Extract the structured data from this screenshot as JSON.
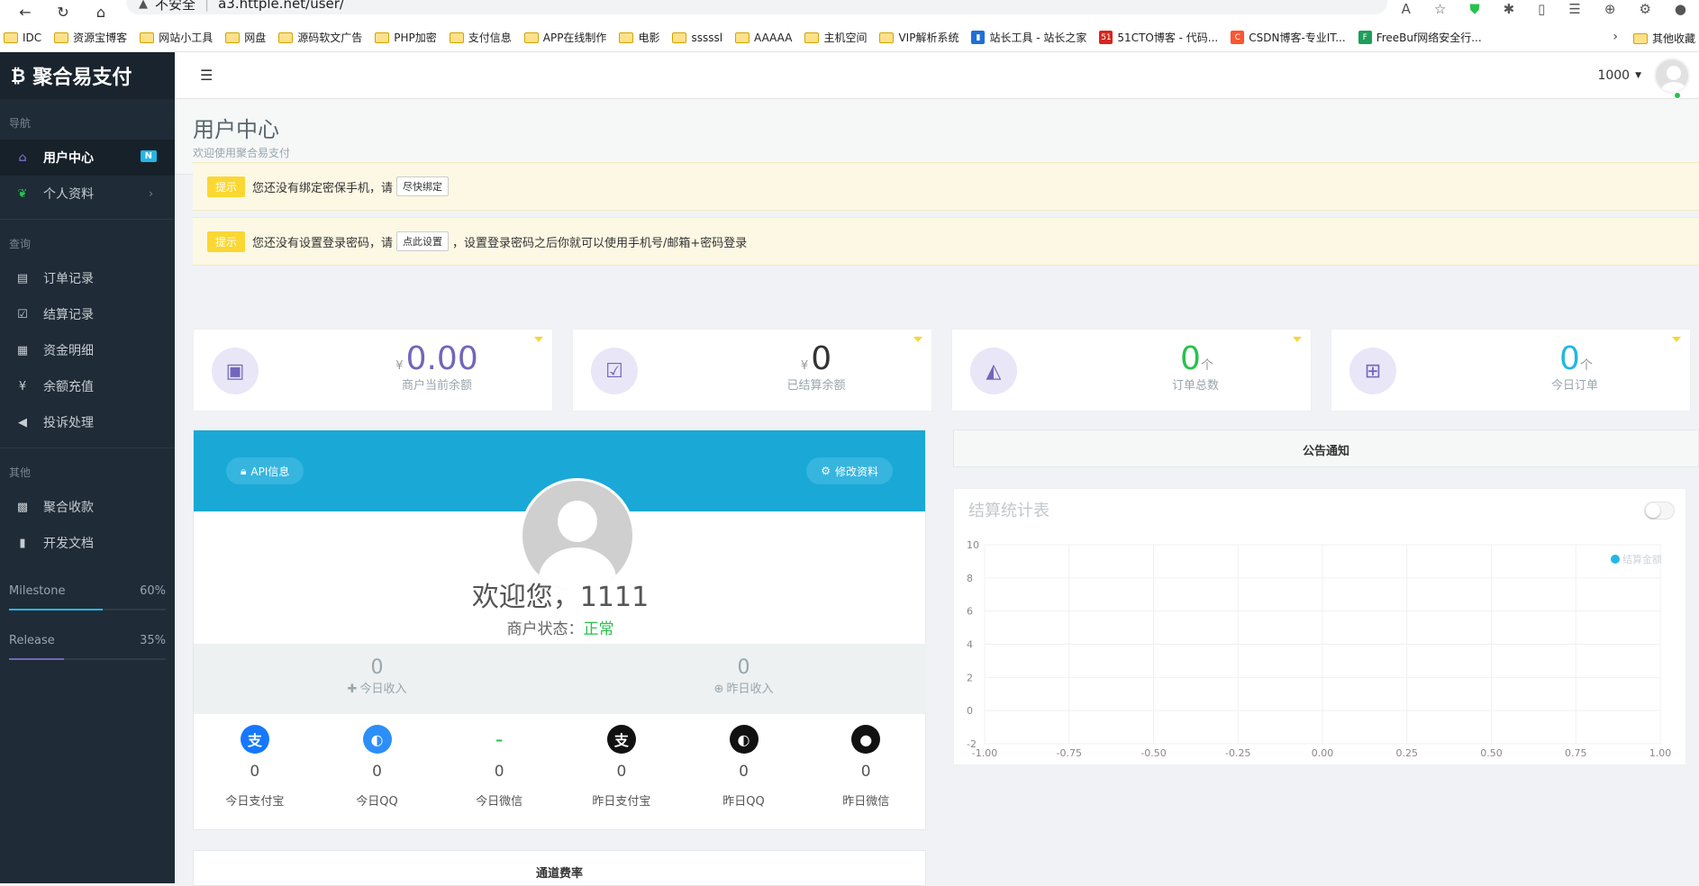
{
  "browser": {
    "security_label": "不安全",
    "url": "a3.httple.net/user/",
    "bookmarks": [
      {
        "label": "IDC",
        "type": "folder"
      },
      {
        "label": "资源宝博客",
        "type": "folder"
      },
      {
        "label": "网站小工具",
        "type": "folder"
      },
      {
        "label": "网盘",
        "type": "folder"
      },
      {
        "label": "源码软文广告",
        "type": "folder"
      },
      {
        "label": "PHP加密",
        "type": "folder"
      },
      {
        "label": "支付信息",
        "type": "folder"
      },
      {
        "label": "APP在线制作",
        "type": "folder"
      },
      {
        "label": "电影",
        "type": "folder"
      },
      {
        "label": "sssssl",
        "type": "folder"
      },
      {
        "label": "AAAAA",
        "type": "folder"
      },
      {
        "label": "主机空间",
        "type": "folder"
      },
      {
        "label": "VIP解析系统",
        "type": "folder"
      },
      {
        "label": "站长工具 - 站长之家",
        "type": "site",
        "color": "#1e6fd9",
        "glyph": "▮"
      },
      {
        "label": "51CTO博客 - 代码...",
        "type": "site",
        "color": "#d9261c",
        "glyph": "51"
      },
      {
        "label": "CSDN博客-专业IT...",
        "type": "site",
        "color": "#fc5531",
        "glyph": "C"
      },
      {
        "label": "FreeBuf网络安全行...",
        "type": "site",
        "color": "#1f9e5a",
        "glyph": "F"
      }
    ],
    "other_bookmarks": "其他收藏"
  },
  "sidebar": {
    "brand": "聚合易支付",
    "brand_icon": "bitcoin-icon",
    "sections": [
      {
        "title": "导航",
        "items": [
          {
            "label": "用户中心",
            "icon": "home-icon",
            "badge": "N",
            "active": true
          },
          {
            "label": "个人资料",
            "icon": "leaf-icon",
            "chevron": true
          }
        ]
      },
      {
        "title": "查询",
        "items": [
          {
            "label": "订单记录",
            "icon": "list-icon"
          },
          {
            "label": "结算记录",
            "icon": "check-square-icon"
          },
          {
            "label": "资金明细",
            "icon": "calendar-icon"
          },
          {
            "label": "余额充值",
            "icon": "yen-icon"
          },
          {
            "label": "投诉处理",
            "icon": "bullhorn-icon"
          }
        ]
      },
      {
        "title": "其他",
        "items": [
          {
            "label": "聚合收款",
            "icon": "qrcode-icon"
          },
          {
            "label": "开发文档",
            "icon": "book-icon"
          }
        ]
      }
    ],
    "progress": [
      {
        "label": "Milestone",
        "percent_text": "60%",
        "value": 0.6,
        "color": "#23b7e5"
      },
      {
        "label": "Release",
        "percent_text": "35%",
        "value": 0.35,
        "color": "#7266ba"
      }
    ]
  },
  "header": {
    "user_name": "1000"
  },
  "page": {
    "title": "用户中心",
    "subtitle": "欢迎使用聚合易支付"
  },
  "alerts": [
    {
      "tag": "提示",
      "before": "您还没有绑定密保手机，请",
      "button": "尽快绑定",
      "after": ""
    },
    {
      "tag": "提示",
      "before": "您还没有设置登录密码，请",
      "button": "点此设置",
      "after": "，设置登录密码之后你就可以使用手机号/邮箱+密码登录"
    }
  ],
  "stats": [
    {
      "prefix": "¥",
      "value": "0.00",
      "suffix": "",
      "label": "商户当前余额",
      "icon": "money-icon",
      "color": "#7266ba"
    },
    {
      "prefix": "¥",
      "value": "0",
      "suffix": "",
      "label": "已结算余额",
      "icon": "check-icon",
      "color": "#333333"
    },
    {
      "prefix": "",
      "value": "0",
      "suffix": "个",
      "label": "订单总数",
      "icon": "area-chart-icon",
      "color": "#27c24c"
    },
    {
      "prefix": "",
      "value": "0",
      "suffix": "个",
      "label": "今日订单",
      "icon": "cart-plus-icon",
      "color": "#23b7e5"
    }
  ],
  "profile": {
    "api_button": "API信息",
    "edit_button": "修改资料",
    "welcome": "欢迎您，1111",
    "status_label": "商户状态：",
    "status_value": "正常",
    "income": [
      {
        "value": "0",
        "label": "今日收入",
        "icon": "plus-icon"
      },
      {
        "value": "0",
        "label": "昨日收入",
        "icon": "plus-circle-icon"
      }
    ],
    "channels": [
      {
        "value": "0",
        "label": "今日支付宝",
        "icon": "alipay-icon",
        "color": "#1677ff",
        "glyph": "支"
      },
      {
        "value": "0",
        "label": "今日QQ",
        "icon": "qq-icon",
        "color": "#2c8ef8",
        "glyph": "◐"
      },
      {
        "value": "0",
        "label": "今日微信",
        "icon": "wechat-icon",
        "color": "#27c24c",
        "glyph": "–"
      },
      {
        "value": "0",
        "label": "昨日支付宝",
        "icon": "alipay-icon",
        "color": "#111111",
        "glyph": "支"
      },
      {
        "value": "0",
        "label": "昨日QQ",
        "icon": "qq-icon",
        "color": "#111111",
        "glyph": "◐"
      },
      {
        "value": "0",
        "label": "昨日微信",
        "icon": "wechat-icon",
        "color": "#111111",
        "glyph": "●"
      }
    ]
  },
  "rate_card": {
    "title": "通道费率"
  },
  "notice": {
    "title": "公告通知"
  },
  "chart_data": {
    "type": "line",
    "title": "结算统计表",
    "series": [
      {
        "name": "结算金额",
        "values": []
      }
    ],
    "x_ticks": [
      "-1.00",
      "-0.75",
      "-0.50",
      "-0.25",
      "0.00",
      "0.25",
      "0.50",
      "0.75",
      "1.00"
    ],
    "y_ticks": [
      "10",
      "8",
      "6",
      "4",
      "2",
      "0",
      "-2"
    ],
    "xlim": [
      -1,
      1
    ],
    "ylim": [
      -2,
      10
    ],
    "grid": true,
    "legend": "top-right",
    "series_color": "#23b7e5"
  }
}
